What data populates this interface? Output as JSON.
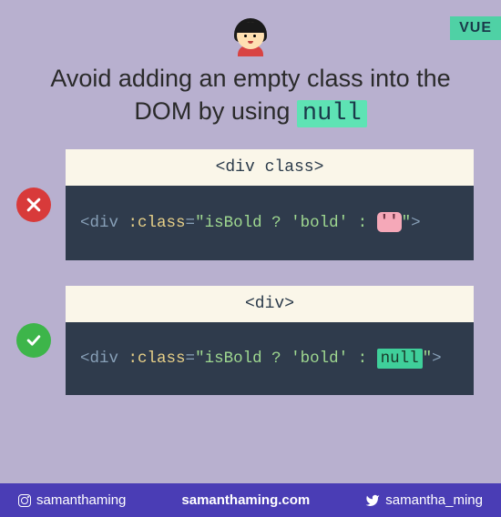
{
  "badge": "VUE",
  "title_part1": "Avoid adding an empty class into the DOM by using ",
  "title_highlight": "null",
  "examples": {
    "bad": {
      "tab_label": "<div class>",
      "code": {
        "open_tag": "<",
        "tag_name": "div ",
        "attr": ":class",
        "eq": "=",
        "str1": "\"isBold ? 'bold' : ",
        "empty": "''",
        "str2": "\"",
        "close": ">"
      }
    },
    "good": {
      "tab_label": "<div>",
      "code": {
        "open_tag": "<",
        "tag_name": "div ",
        "attr": ":class",
        "eq": "=",
        "str1": "\"isBold ? 'bold' : ",
        "null_val": "null",
        "str2": "\"",
        "close": ">"
      }
    }
  },
  "footer": {
    "instagram": "samanthaming",
    "site": "samanthaming.com",
    "twitter": "samantha_ming"
  }
}
